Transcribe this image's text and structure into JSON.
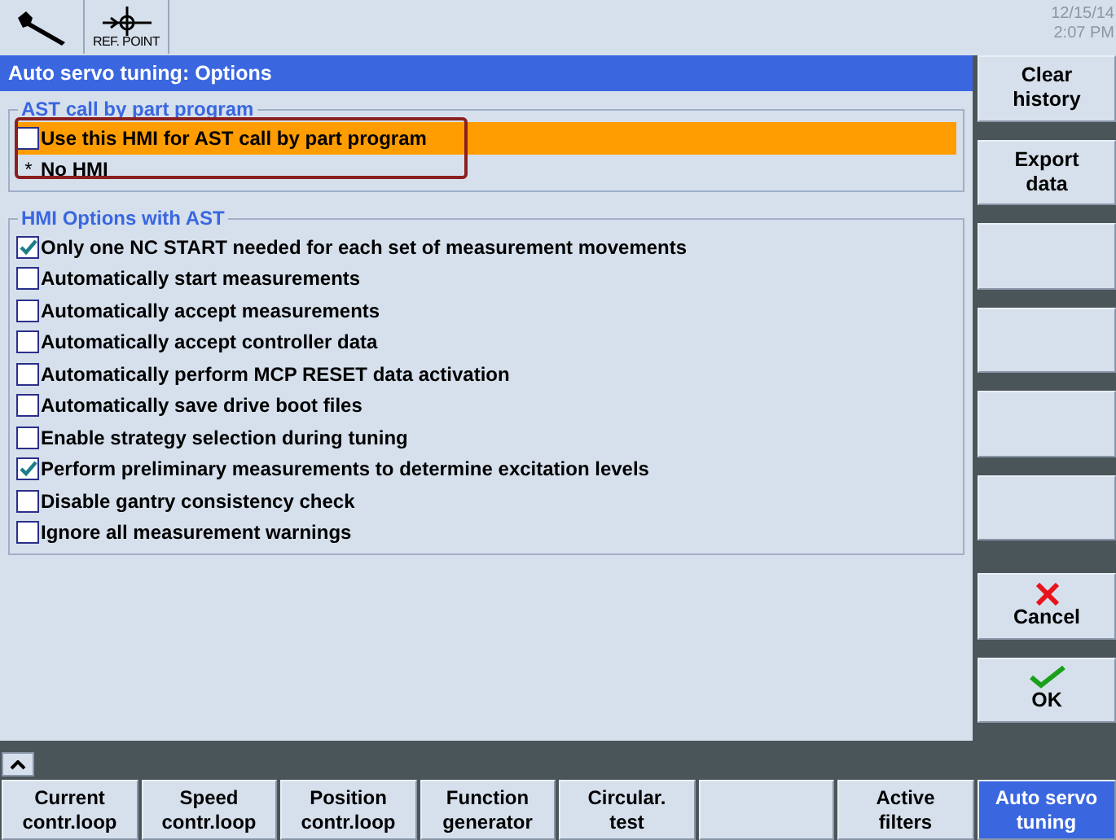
{
  "header": {
    "ref_point_label": "REF. POINT",
    "date": "12/15/14",
    "time": "2:07 PM"
  },
  "title": "Auto servo tuning: Options",
  "ast_group": {
    "title": "AST call by part program",
    "options": [
      {
        "kind": "checkbox",
        "label": "Use this HMI for AST call by part program",
        "checked": false,
        "selected": true
      },
      {
        "kind": "marked",
        "marker": "*",
        "label": "No HMI",
        "selected": false
      }
    ]
  },
  "hmi_group": {
    "title": "HMI Options with AST",
    "options": [
      {
        "label": "Only one NC START needed for each set of measurement movements",
        "checked": true
      },
      {
        "label": "Automatically start measurements",
        "checked": false
      },
      {
        "label": "Automatically accept measurements",
        "checked": false
      },
      {
        "label": "Automatically accept controller data",
        "checked": false
      },
      {
        "label": "Automatically perform MCP RESET data activation",
        "checked": false
      },
      {
        "label": "Automatically save drive boot files",
        "checked": false
      },
      {
        "label": "Enable strategy selection during tuning",
        "checked": false
      },
      {
        "label": "Perform preliminary measurements to determine excitation levels",
        "checked": true
      },
      {
        "label": "Disable gantry consistency check",
        "checked": false
      },
      {
        "label": "Ignore all measurement warnings",
        "checked": false
      }
    ]
  },
  "vertical_softkeys": [
    {
      "kind": "text",
      "lines": [
        "Clear",
        "history"
      ]
    },
    {
      "kind": "text",
      "lines": [
        "Export",
        "data"
      ]
    },
    {
      "kind": "empty"
    },
    {
      "kind": "empty"
    },
    {
      "kind": "empty"
    },
    {
      "kind": "empty"
    },
    {
      "kind": "cancel",
      "lines": [
        "Cancel"
      ]
    },
    {
      "kind": "ok",
      "lines": [
        "OK"
      ]
    }
  ],
  "horizontal_softkeys": [
    {
      "lines": [
        "Current",
        "contr.loop"
      ],
      "selected": false
    },
    {
      "lines": [
        "Speed",
        "contr.loop"
      ],
      "selected": false
    },
    {
      "lines": [
        "Position",
        "contr.loop"
      ],
      "selected": false
    },
    {
      "lines": [
        "Function",
        "generator"
      ],
      "selected": false
    },
    {
      "lines": [
        "Circular.",
        "test"
      ],
      "selected": false
    },
    {
      "selected": false
    },
    {
      "lines": [
        "Active",
        "filters"
      ],
      "selected": false
    },
    {
      "lines": [
        "Auto servo",
        "tuning"
      ],
      "selected": true
    }
  ]
}
